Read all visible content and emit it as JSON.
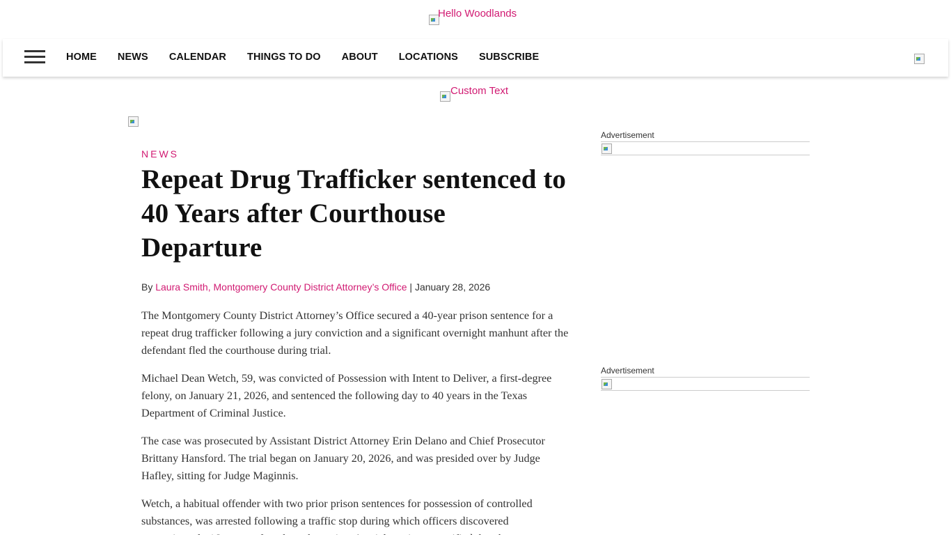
{
  "site": {
    "logo_alt": "Hello Woodlands",
    "banner_alt": "Custom Text"
  },
  "nav": {
    "menu": [
      "HOME",
      "NEWS",
      "CALENDAR",
      "THINGS TO DO",
      "ABOUT",
      "LOCATIONS",
      "SUBSCRIBE"
    ]
  },
  "article": {
    "category": "NEWS",
    "title": "Repeat Drug Trafficker sentenced to 40 Years after Courthouse Departure",
    "by_prefix": "By",
    "author": "Laura Smith, Montgomery County District Attorney’s Office",
    "separator": "|",
    "date": "January 28, 2026",
    "paragraphs": [
      "The Montgomery County District Attorney’s Office secured a 40-year prison sentence for a repeat drug trafficker following a jury conviction and a significant overnight manhunt after the defendant fled the courthouse during trial.",
      "Michael Dean Wetch, 59, was convicted of Possession with Intent to Deliver, a first-degree felony, on January 21, 2026, and sentenced the following day to 40 years in the Texas Department of Criminal Justice.",
      "The case was prosecuted by Assistant District Attorney Erin Delano and Chief Prosecutor Brittany Hansford. The trial began on January 20, 2026, and was presided over by Judge Hafley, sitting for Judge Maginnis.",
      "Wetch, a habitual offender with two prior prison sentences for possession of controlled substances, was arrested following a traffic stop during which officers discovered approximately 16 grams of methamphetamine. At trial, a witness testified that the"
    ]
  },
  "sidebar": {
    "ad1_label": "Advertisement",
    "ad2_label": "Advertisement"
  },
  "colors": {
    "accent": "#d11a72",
    "text": "#333333",
    "heading": "#111111"
  },
  "icons": {
    "menu": "hamburger-icon",
    "broken_image": "broken-image-icon"
  }
}
